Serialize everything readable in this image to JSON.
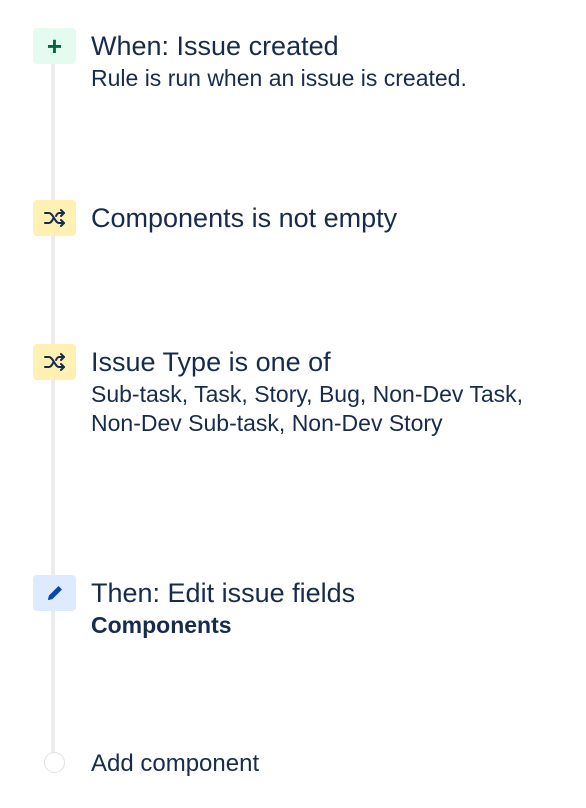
{
  "rule": {
    "steps": [
      {
        "kind": "trigger",
        "icon": "plus-icon",
        "title": "When: Issue created",
        "description": "Rule is run when an issue is created."
      },
      {
        "kind": "condition",
        "icon": "shuffle-icon",
        "title": "Components is not empty",
        "description": ""
      },
      {
        "kind": "condition",
        "icon": "shuffle-icon",
        "title": "Issue Type is one of",
        "description": "Sub-task, Task, Story, Bug, Non-Dev Task, Non-Dev Sub-task, Non-Dev Story"
      },
      {
        "kind": "action",
        "icon": "pencil-icon",
        "title": "Then: Edit issue fields",
        "description": "Components"
      }
    ],
    "add_component_label": "Add component"
  },
  "colors": {
    "trigger_bg": "#e3fcef",
    "trigger_fg": "#006644",
    "condition_bg": "#fff0b3",
    "action_bg": "#deebff",
    "action_fg": "#0747a6",
    "text": "#172b4d",
    "rail": "#ebecf0"
  }
}
